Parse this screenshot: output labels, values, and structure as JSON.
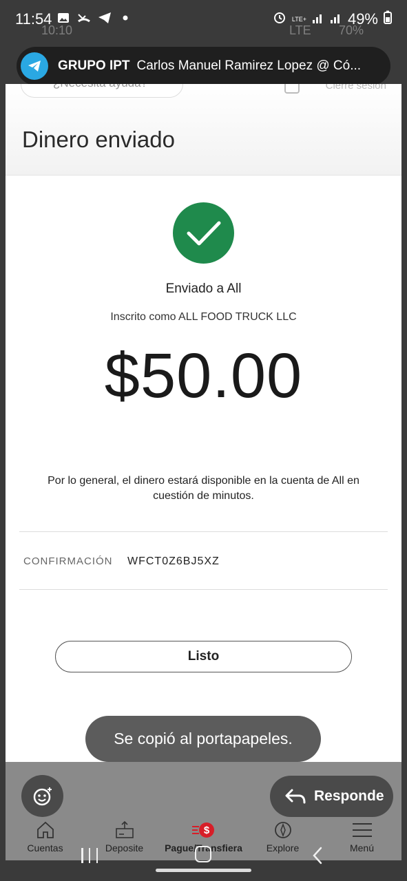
{
  "status_bar": {
    "time": "11:54",
    "battery": "49%",
    "network": "LTE+",
    "ghost_time": "10:10",
    "ghost_network": "LTE",
    "ghost_battery": "70%"
  },
  "notification": {
    "app": "GRUPO IPT",
    "message": "Carlos Manuel Ramirez Lopez @ Có..."
  },
  "app_header": {
    "help_placeholder": "¿Necesita ayuda?",
    "sign_out": "Cierre sesión"
  },
  "page": {
    "title": "Dinero enviado",
    "sent_to": "Enviado a All",
    "registered_as": "Inscrito como ALL FOOD TRUCK LLC",
    "amount": "$50.00",
    "note": "Por lo general, el dinero estará disponible en la cuenta de All en cuestión de minutos.",
    "confirmation_label": "CONFIRMACIÓN",
    "confirmation_value": "WFCT0Z6BJ5XZ",
    "done_button": "Listo"
  },
  "toast": "Se copió al portapapeles.",
  "reply_button": "Responde",
  "tabs": [
    {
      "label": "Cuentas",
      "icon": "home-icon"
    },
    {
      "label": "Deposite",
      "icon": "deposit-icon"
    },
    {
      "label": "Pague/Transfiera",
      "icon": "pay-transfer-icon"
    },
    {
      "label": "Explore",
      "icon": "compass-icon"
    },
    {
      "label": "Menú",
      "icon": "menu-icon"
    }
  ],
  "colors": {
    "success_green": "#1f8a4c",
    "telegram_blue": "#2aa8e3",
    "brand_red": "#d71e28"
  }
}
